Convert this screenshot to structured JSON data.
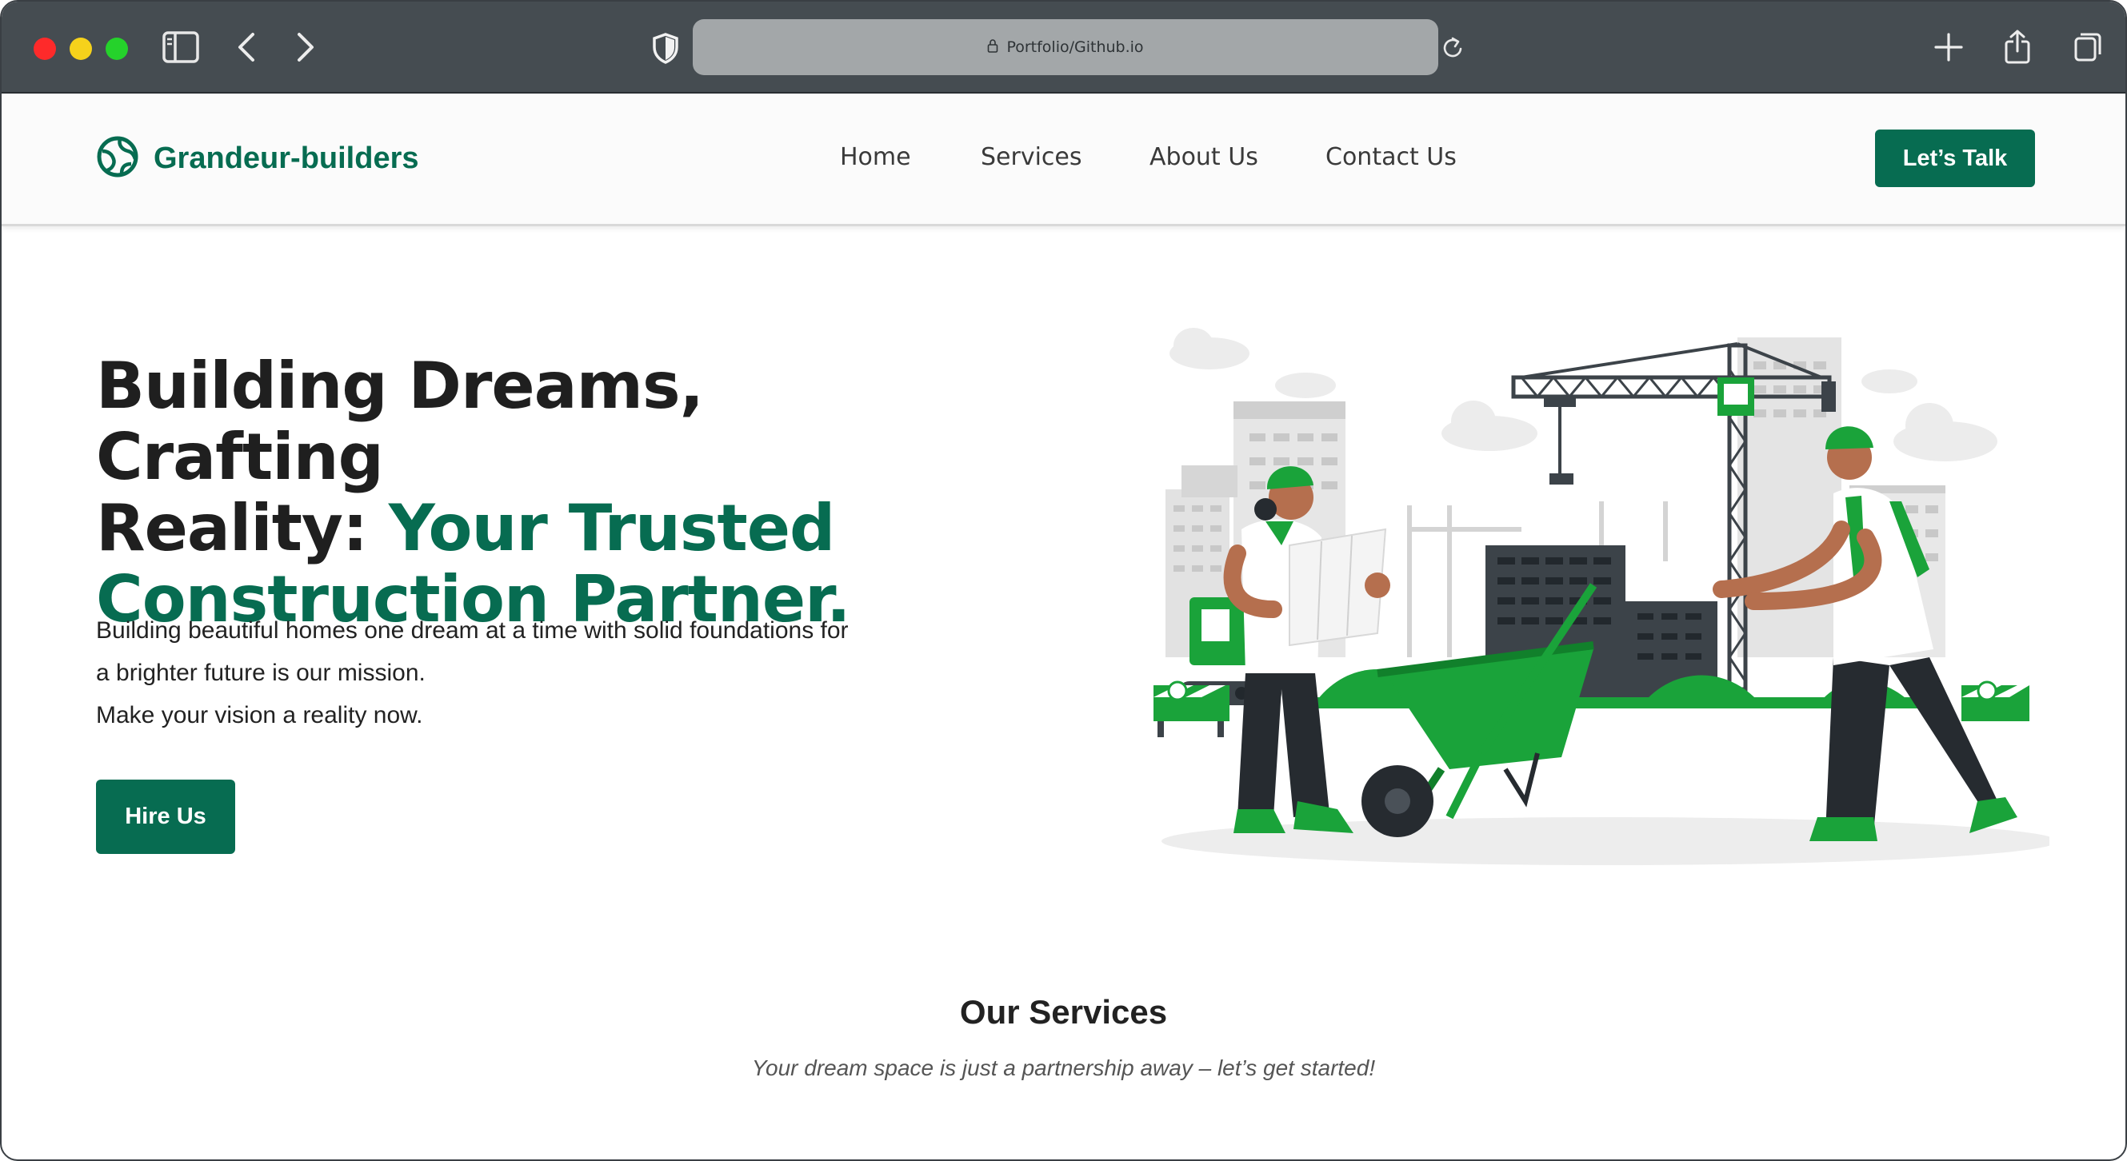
{
  "browser": {
    "url": "Portfolio/Github.io",
    "icons": [
      "sidebar-icon",
      "back-icon",
      "forward-icon",
      "shield-icon",
      "lock-icon",
      "reload-icon",
      "new-tab-icon",
      "share-icon",
      "tabs-icon"
    ]
  },
  "nav": {
    "brand": "Grandeur-builders",
    "links": [
      "Home",
      "Services",
      "About Us",
      "Contact Us"
    ],
    "cta": "Let’s Talk"
  },
  "hero": {
    "title_line1": "Building Dreams, Crafting",
    "title_line2_plain": "Reality: ",
    "title_line2_accent": "Your Trusted",
    "title_line3_accent": "Construction Partner.",
    "desc_line1": "Building beautiful homes one dream at a time with solid foundations for",
    "desc_line2": "a brighter future is our mission.",
    "desc_line3": "Make your vision a reality now.",
    "button": "Hire Us"
  },
  "services": {
    "title": "Our Services",
    "subtitle": "Your dream space is just a partnership away – let’s get started!"
  },
  "colors": {
    "brand_green": "#076c51",
    "illustration_green": "#1aa33a",
    "chrome_bg": "#454c51"
  }
}
